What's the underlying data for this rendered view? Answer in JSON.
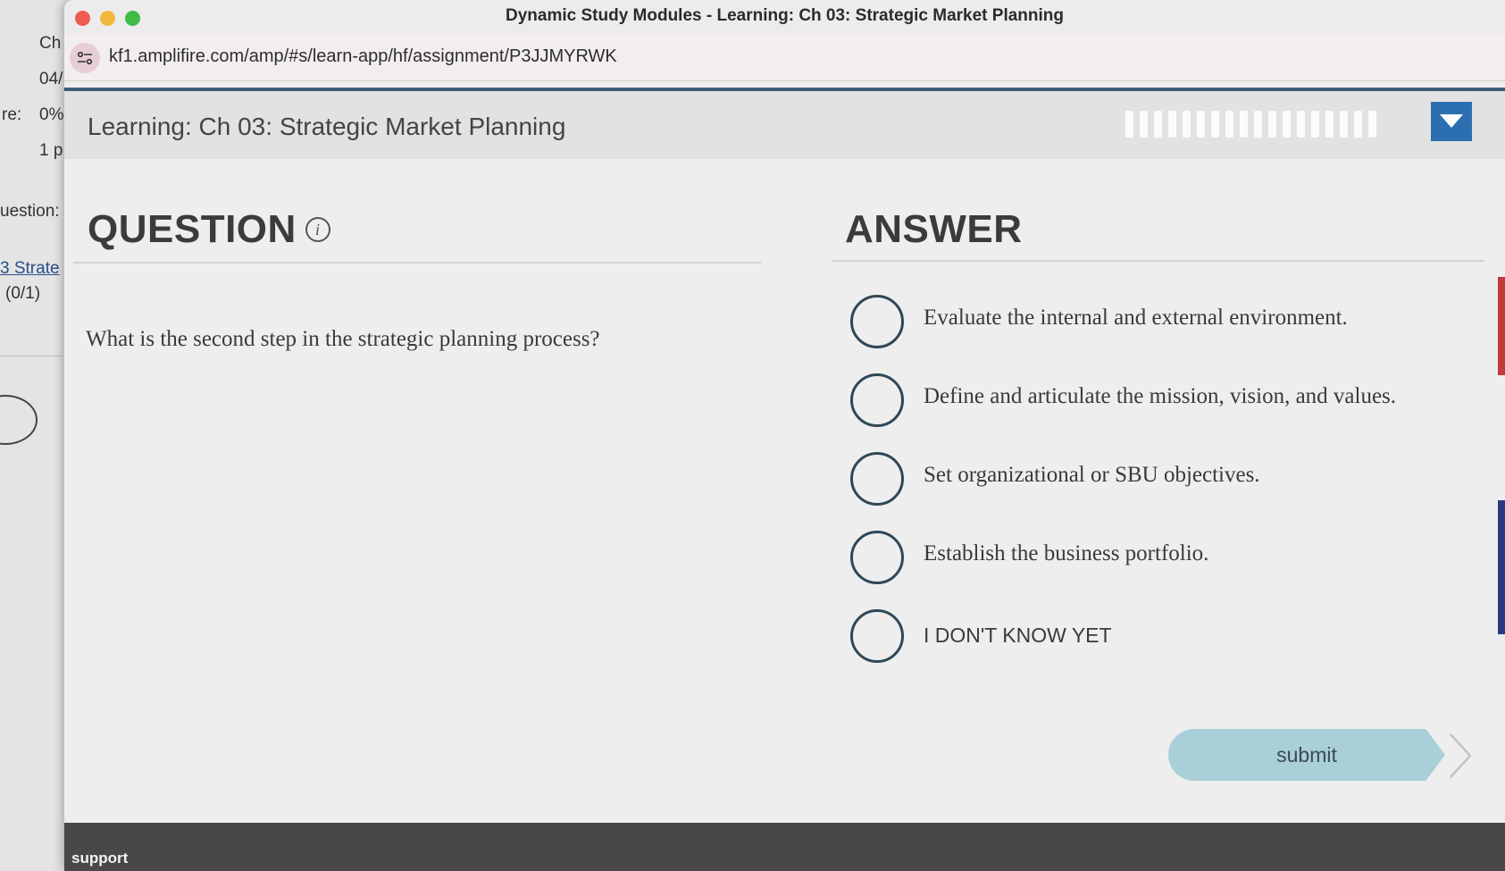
{
  "background_page": {
    "fragments": [
      "Ch",
      "04/",
      "re:",
      "0%",
      "1 p",
      "uestion:",
      "3 Strate",
      "(0/1)"
    ]
  },
  "window": {
    "title": "Dynamic Study Modules - Learning: Ch 03: Strategic Market Planning",
    "url": "kf1.amplifire.com/amp/#s/learn-app/hf/assignment/P3JJMYRWK"
  },
  "header": {
    "title": "Learning: Ch 03: Strategic Market Planning",
    "progress_segments": 18,
    "accent_color": "#2b6fb0"
  },
  "question": {
    "heading": "QUESTION",
    "text": "What is the second step in the strategic planning process?"
  },
  "answer": {
    "heading": "ANSWER",
    "options": [
      {
        "label": "Evaluate the internal and external environment."
      },
      {
        "label": "Define and articulate the mission, vision, and values."
      },
      {
        "label": "Set organizational or SBU objectives."
      },
      {
        "label": "Establish the business portfolio."
      },
      {
        "label": "I DON'T KNOW YET"
      }
    ]
  },
  "submit_label": "submit",
  "footer": {
    "support_label": "support"
  }
}
